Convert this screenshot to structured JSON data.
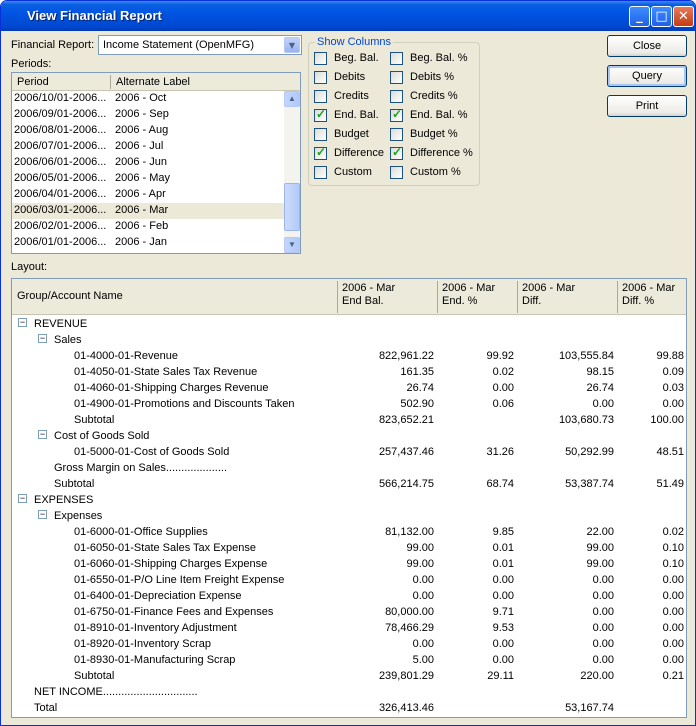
{
  "window": {
    "title": "View Financial Report"
  },
  "form": {
    "financial_report_label": "Financial Report:",
    "financial_report_value": "Income Statement (OpenMFG)",
    "periods_label": "Periods:",
    "layout_label": "Layout:"
  },
  "periods": {
    "columns": [
      "Period",
      "Alternate Label"
    ],
    "rows": [
      {
        "period": "2006/10/01-2006...",
        "label": "2006 - Oct"
      },
      {
        "period": "2006/09/01-2006...",
        "label": "2006 - Sep"
      },
      {
        "period": "2006/08/01-2006...",
        "label": "2006 - Aug"
      },
      {
        "period": "2006/07/01-2006...",
        "label": "2006 - Jul"
      },
      {
        "period": "2006/06/01-2006...",
        "label": "2006 - Jun"
      },
      {
        "period": "2006/05/01-2006...",
        "label": "2006 - May"
      },
      {
        "period": "2006/04/01-2006...",
        "label": "2006 - Apr"
      },
      {
        "period": "2006/03/01-2006...",
        "label": "2006 - Mar"
      },
      {
        "period": "2006/02/01-2006...",
        "label": "2006 - Feb"
      },
      {
        "period": "2006/01/01-2006...",
        "label": "2006 - Jan"
      }
    ]
  },
  "show_columns": {
    "title": "Show Columns",
    "left": [
      {
        "label": "Beg. Bal.",
        "checked": false
      },
      {
        "label": "Debits",
        "checked": false
      },
      {
        "label": "Credits",
        "checked": false
      },
      {
        "label": "End. Bal.",
        "checked": true
      },
      {
        "label": "Budget",
        "checked": false
      },
      {
        "label": "Difference",
        "checked": true
      },
      {
        "label": "Custom",
        "checked": false
      }
    ],
    "right": [
      {
        "label": "Beg. Bal. %",
        "checked": false
      },
      {
        "label": "Debits %",
        "checked": false
      },
      {
        "label": "Credits %",
        "checked": false
      },
      {
        "label": "End. Bal. %",
        "checked": true
      },
      {
        "label": "Budget %",
        "checked": false
      },
      {
        "label": "Difference %",
        "checked": true
      },
      {
        "label": "Custom %",
        "checked": false
      }
    ]
  },
  "buttons": {
    "close": "Close",
    "query": "Query",
    "print": "Print"
  },
  "layout": {
    "headers": [
      {
        "line1": "Group/Account Name",
        "line2": ""
      },
      {
        "line1": "2006 - Mar",
        "line2": "End Bal."
      },
      {
        "line1": "2006 - Mar",
        "line2": "End. %"
      },
      {
        "line1": "2006 - Mar",
        "line2": "Diff."
      },
      {
        "line1": "2006 - Mar",
        "line2": "Diff. %"
      }
    ],
    "rows": [
      {
        "name": "REVENUE",
        "c1": "",
        "c2": "",
        "c3": "",
        "c4": ""
      },
      {
        "name": "Sales",
        "c1": "",
        "c2": "",
        "c3": "",
        "c4": ""
      },
      {
        "name": "01-4000-01-Revenue",
        "c1": "822,961.22",
        "c2": "99.92",
        "c3": "103,555.84",
        "c4": "99.88"
      },
      {
        "name": "01-4050-01-State Sales Tax Revenue",
        "c1": "161.35",
        "c2": "0.02",
        "c3": "98.15",
        "c4": "0.09"
      },
      {
        "name": "01-4060-01-Shipping Charges Revenue",
        "c1": "26.74",
        "c2": "0.00",
        "c3": "26.74",
        "c4": "0.03"
      },
      {
        "name": "01-4900-01-Promotions and Discounts Taken",
        "c1": "502.90",
        "c2": "0.06",
        "c3": "0.00",
        "c4": "0.00"
      },
      {
        "name": "Subtotal",
        "c1": "823,652.21",
        "c2": "",
        "c3": "103,680.73",
        "c4": "100.00"
      },
      {
        "name": "Cost of Goods Sold",
        "c1": "",
        "c2": "",
        "c3": "",
        "c4": ""
      },
      {
        "name": "01-5000-01-Cost of Goods Sold",
        "c1": "257,437.46",
        "c2": "31.26",
        "c3": "50,292.99",
        "c4": "48.51"
      },
      {
        "name": "Gross Margin on Sales....................",
        "c1": "",
        "c2": "",
        "c3": "",
        "c4": ""
      },
      {
        "name": "Subtotal",
        "c1": "566,214.75",
        "c2": "68.74",
        "c3": "53,387.74",
        "c4": "51.49"
      },
      {
        "name": "EXPENSES",
        "c1": "",
        "c2": "",
        "c3": "",
        "c4": ""
      },
      {
        "name": "Expenses",
        "c1": "",
        "c2": "",
        "c3": "",
        "c4": ""
      },
      {
        "name": "01-6000-01-Office Supplies",
        "c1": "81,132.00",
        "c2": "9.85",
        "c3": "22.00",
        "c4": "0.02"
      },
      {
        "name": "01-6050-01-State Sales Tax Expense",
        "c1": "99.00",
        "c2": "0.01",
        "c3": "99.00",
        "c4": "0.10"
      },
      {
        "name": "01-6060-01-Shipping Charges Expense",
        "c1": "99.00",
        "c2": "0.01",
        "c3": "99.00",
        "c4": "0.10"
      },
      {
        "name": "01-6550-01-P/O Line Item Freight Expense",
        "c1": "0.00",
        "c2": "0.00",
        "c3": "0.00",
        "c4": "0.00"
      },
      {
        "name": "01-6400-01-Depreciation Expense",
        "c1": "0.00",
        "c2": "0.00",
        "c3": "0.00",
        "c4": "0.00"
      },
      {
        "name": "01-6750-01-Finance Fees and Expenses",
        "c1": "80,000.00",
        "c2": "9.71",
        "c3": "0.00",
        "c4": "0.00"
      },
      {
        "name": "01-8910-01-Inventory Adjustment",
        "c1": "78,466.29",
        "c2": "9.53",
        "c3": "0.00",
        "c4": "0.00"
      },
      {
        "name": "01-8920-01-Inventory Scrap",
        "c1": "0.00",
        "c2": "0.00",
        "c3": "0.00",
        "c4": "0.00"
      },
      {
        "name": "01-8930-01-Manufacturing Scrap",
        "c1": "5.00",
        "c2": "0.00",
        "c3": "0.00",
        "c4": "0.00"
      },
      {
        "name": "Subtotal",
        "c1": "239,801.29",
        "c2": "29.11",
        "c3": "220.00",
        "c4": "0.21"
      },
      {
        "name": "NET INCOME...............................",
        "c1": "",
        "c2": "",
        "c3": "",
        "c4": ""
      },
      {
        "name": "Total",
        "c1": "326,413.46",
        "c2": "",
        "c3": "53,167.74",
        "c4": ""
      }
    ]
  }
}
